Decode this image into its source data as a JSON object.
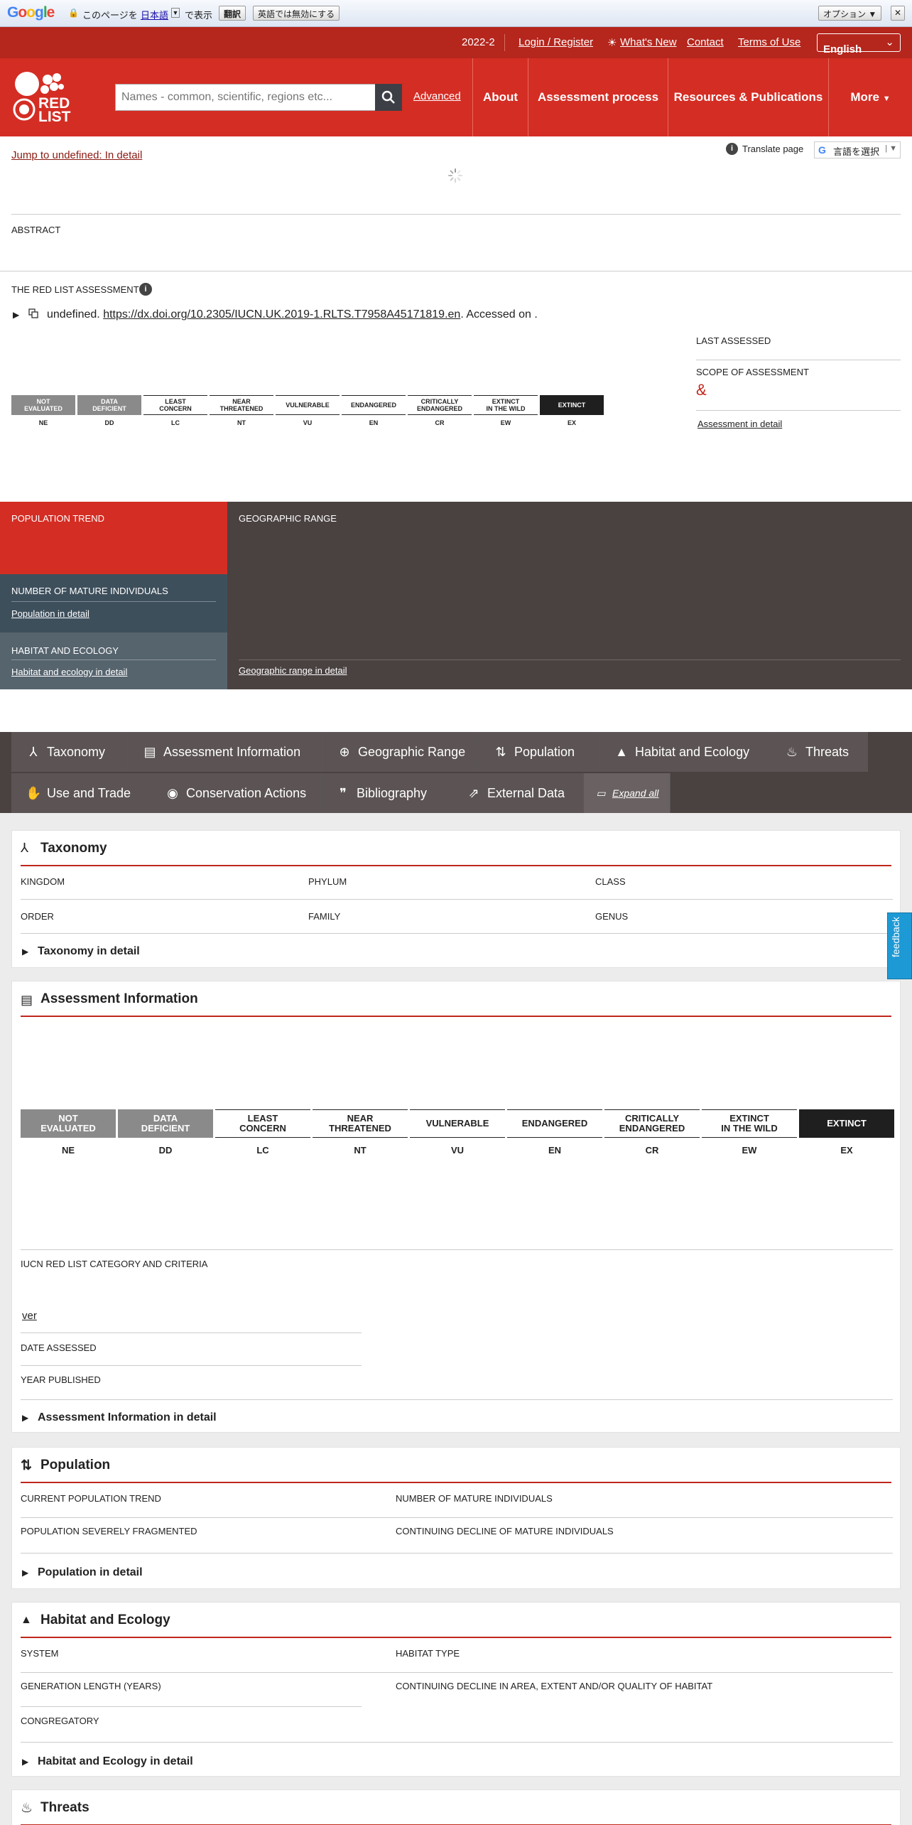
{
  "google_bar": {
    "logo": "Google",
    "prefix": "このページを",
    "language_link": "日本語",
    "suffix": "で表示",
    "translate_button": "翻訳",
    "disable_button": "英語では無効にする",
    "options_button": "オプション ▼",
    "close": "✕"
  },
  "top_links": {
    "version": "2022-2",
    "login": "Login / Register",
    "whats_new": "What's New",
    "contact": "Contact",
    "terms": "Terms of Use",
    "language": "English"
  },
  "header": {
    "logo_text": "RED LIST",
    "search_placeholder": "Names - common, scientific, regions etc...",
    "advanced": "Advanced",
    "nav": [
      "About",
      "Assessment process",
      "Resources & Publications",
      "More"
    ]
  },
  "jump_link": "Jump to undefined: In detail",
  "translate": {
    "label": "Translate page",
    "select": "言語を選択"
  },
  "abstract_label": "ABSTRACT",
  "assessment": {
    "label": "THE RED LIST ASSESSMENT",
    "citation_prefix": "undefined. ",
    "citation_link": "https://dx.doi.org/10.2305/IUCN.UK.2019-1.RLTS.T7958A45171819.en",
    "citation_suffix": ". Accessed on .",
    "last_assessed": "LAST ASSESSED",
    "scope": "SCOPE OF ASSESSMENT",
    "scope_value": "&",
    "detail_link": "Assessment in detail"
  },
  "categories": [
    {
      "name": "NOT\nEVALUATED",
      "code": "NE"
    },
    {
      "name": "DATA\nDEFICIENT",
      "code": "DD"
    },
    {
      "name": "LEAST\nCONCERN",
      "code": "LC"
    },
    {
      "name": "NEAR\nTHREATENED",
      "code": "NT"
    },
    {
      "name": "VULNERABLE",
      "code": "VU"
    },
    {
      "name": "ENDANGERED",
      "code": "EN"
    },
    {
      "name": "CRITICALLY\nENDANGERED",
      "code": "CR"
    },
    {
      "name": "EXTINCT\nIN THE WILD",
      "code": "EW"
    },
    {
      "name": "EXTINCT",
      "code": "EX"
    }
  ],
  "panels": {
    "population_trend": "POPULATION TREND",
    "geographic_range": "GEOGRAPHIC RANGE",
    "mature_individuals": "NUMBER OF MATURE INDIVIDUALS",
    "population_link": "Population in detail",
    "habitat": "HABITAT AND ECOLOGY",
    "habitat_link": "Habitat and ecology in detail",
    "geo_link": "Geographic range in detail"
  },
  "tabs": {
    "row1": [
      "Taxonomy",
      "Assessment Information",
      "Geographic Range",
      "Population",
      "Habitat and Ecology",
      "Threats"
    ],
    "row2": [
      "Use and Trade",
      "Conservation Actions",
      "Bibliography",
      "External Data"
    ],
    "expand_all": "Expand all"
  },
  "taxonomy": {
    "title": "Taxonomy",
    "kingdom": "KINGDOM",
    "phylum": "PHYLUM",
    "class": "CLASS",
    "order": "ORDER",
    "family": "FAMILY",
    "genus": "GENUS",
    "detail": "Taxonomy in detail"
  },
  "assessment_info": {
    "title": "Assessment Information",
    "criteria": "IUCN RED LIST CATEGORY AND CRITERIA",
    "ver": "ver",
    "date_assessed": "DATE ASSESSED",
    "year_published": "YEAR PUBLISHED",
    "detail": "Assessment Information in detail"
  },
  "population": {
    "title": "Population",
    "current_trend": "CURRENT POPULATION TREND",
    "mature": "NUMBER OF MATURE INDIVIDUALS",
    "fragmented": "POPULATION SEVERELY FRAGMENTED",
    "continuing_decline": "CONTINUING DECLINE OF MATURE INDIVIDUALS",
    "detail": "Population in detail"
  },
  "habitat": {
    "title": "Habitat and Ecology",
    "system": "SYSTEM",
    "habitat_type": "HABITAT TYPE",
    "generation_length": "GENERATION LENGTH (YEARS)",
    "continuing_decline": "CONTINUING DECLINE IN AREA, EXTENT AND/OR QUALITY OF HABITAT",
    "congregatory": "CONGREGATORY",
    "detail": "Habitat and Ecology in detail"
  },
  "threats": {
    "title": "Threats"
  },
  "feedback": "feedback",
  "colors": {
    "red": "#d42d24",
    "dark_red": "#b5261d",
    "panel_dark": "#4a4141",
    "panel_slate": "#3e4f5c",
    "extinct": "#1f1f1f"
  }
}
